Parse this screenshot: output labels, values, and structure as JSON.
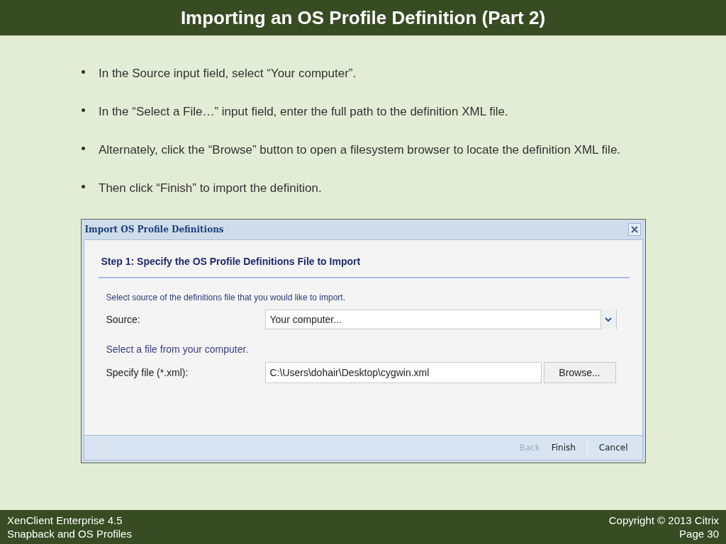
{
  "slide": {
    "title": "Importing an OS Profile Definition (Part 2)"
  },
  "bullets": [
    "In the Source input field, select “Your computer”.",
    "In the “Select a File…” input field, enter the full path to the definition XML file.",
    "Alternately, click the “Browse” button to open a filesystem browser to locate the definition XML file.",
    "Then click “Finish” to import the definition."
  ],
  "dialog": {
    "title": "Import OS Profile Definitions",
    "step_heading": "Step 1: Specify the OS Profile Definitions File to Import",
    "intro": "Select source of the definitions file that you would like to import.",
    "source_label": "Source:",
    "source_value": "Your computer...",
    "file_hint": "Select a file from your computer.",
    "file_label": "Specify file (*.xml):",
    "file_value": "C:\\Users\\dohair\\Desktop\\cygwin.xml",
    "browse_button": "Browse...",
    "footer_buttons": [
      {
        "label": "Back",
        "disabled": true
      },
      {
        "label": "Finish",
        "disabled": false
      },
      {
        "label": "Cancel",
        "disabled": false
      }
    ]
  },
  "footer": {
    "left": [
      "XenClient Enterprise 4.5",
      "Snapback and OS Profiles"
    ],
    "right": [
      "Copyright © 2013 Citrix",
      "Page 30"
    ]
  }
}
